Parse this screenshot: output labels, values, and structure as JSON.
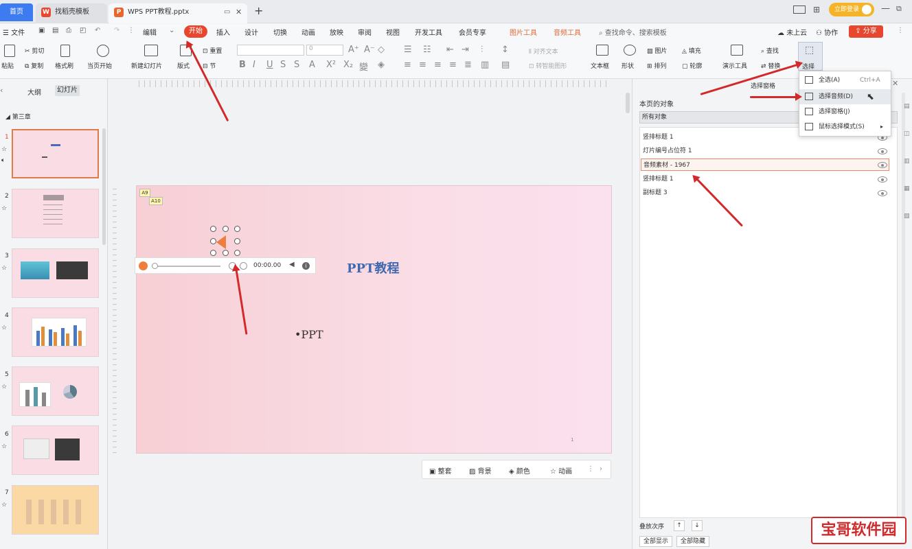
{
  "tabs": {
    "home": "首页",
    "template": "找稻壳模板",
    "doc": "WPS PPT教程.pptx",
    "new_tab": "+"
  },
  "topright": {
    "login": "立即登录",
    "cloud": "未上云",
    "collab": "协作",
    "share": "分享"
  },
  "menu": {
    "file": "文件",
    "edit": "编辑",
    "start": "开始",
    "insert": "插入",
    "design": "设计",
    "transition": "切换",
    "animation": "动画",
    "slideshow": "放映",
    "review": "审阅",
    "view": "视图",
    "developer": "开发工具",
    "member": "会员专享",
    "picture_tools": "图片工具",
    "audio_tools": "音频工具",
    "search": "查找命令、搜索模板"
  },
  "ribbon": {
    "paste": "粘贴",
    "cut": "剪切",
    "copy": "复制",
    "format_painter": "格式刷",
    "from_start": "当页开始",
    "new_slide": "新建幻灯片",
    "layout": "版式",
    "section": "节",
    "reset": "重置",
    "font_size": "0",
    "align_text": "对齐文本",
    "smartart": "转智能图形",
    "textbox": "文本框",
    "shape": "形状",
    "picture": "图片",
    "arrange": "排列",
    "fill": "填充",
    "outline": "轮廓",
    "presenter": "演示工具",
    "find": "查找",
    "replace": "替换",
    "select": "选择"
  },
  "left_panel": {
    "outline": "大纲",
    "slides": "幻灯片",
    "chapter": "第三章",
    "slide_numbers": [
      "1",
      "2",
      "3",
      "4",
      "5",
      "6",
      "7"
    ]
  },
  "slide": {
    "title": "PPT教程",
    "bullet": "•PPT",
    "audio_time": "00:00.00",
    "tag1": "A9",
    "tag2": "A10",
    "page_num": "1"
  },
  "bottom_toolbar": {
    "unify": "整套",
    "background": "背景",
    "color": "颜色",
    "animation": "动画"
  },
  "selection_pane": {
    "title": "选择窗格",
    "objects_on_page": "本页的对象",
    "all_objects": "所有对象",
    "items": [
      "竖排标题 1",
      "灯片编号占位符 1",
      "音频素材 - 1967",
      "竖排标题 1",
      "副标题 3"
    ],
    "order_label": "叠放次序",
    "show_all": "全部显示",
    "hide_all": "全部隐藏"
  },
  "dropdown": {
    "select_all": "全选(A)",
    "select_all_shortcut": "Ctrl+A",
    "select_audio": "选择音频(D)",
    "select_pane": "选择窗格(J)",
    "mouse_mode": "鼠标选择模式(S)"
  },
  "watermark": "宝哥软件园",
  "colors": {
    "accent": "#e8472f",
    "home_tab": "#3d7cf0",
    "slide_title": "#3f68b0",
    "arrow": "#d22a2a",
    "watermark": "#d22a2a"
  }
}
